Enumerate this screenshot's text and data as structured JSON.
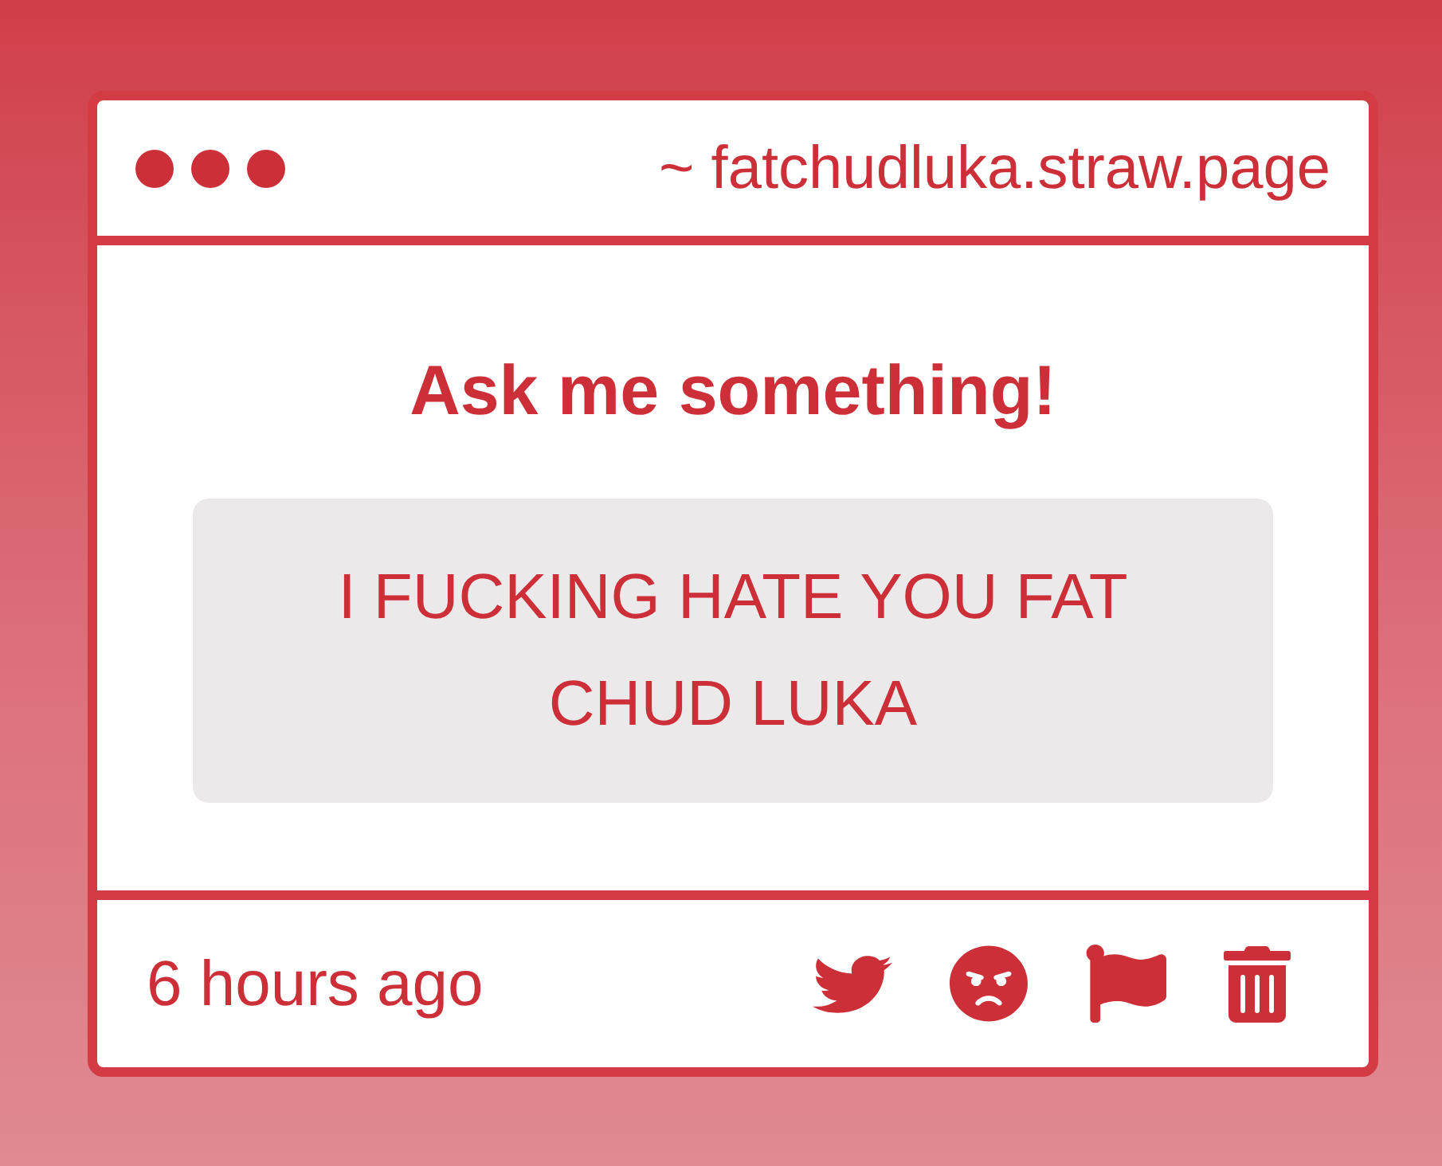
{
  "window": {
    "address": "~ fatchudluka.straw.page"
  },
  "prompt": {
    "heading": "Ask me something!",
    "question": "I FUCKING HATE YOU FAT CHUD LUKA"
  },
  "footer": {
    "time": "6 hours ago",
    "actions": [
      {
        "kind": "share"
      },
      {
        "kind": "react"
      },
      {
        "kind": "report"
      },
      {
        "kind": "delete"
      }
    ]
  }
}
